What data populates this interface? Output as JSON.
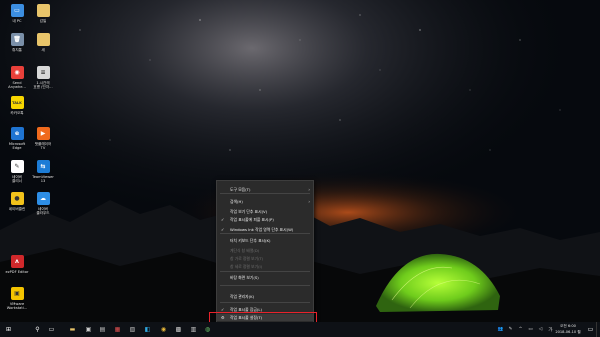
{
  "desktop_icons": [
    {
      "label": "내 PC",
      "icon": "pc-icon",
      "color": "#3c8ee0",
      "glyph": "▭"
    },
    {
      "label": "감일",
      "icon": "folder-icon",
      "color": "#e8c46a",
      "glyph": ""
    },
    {
      "label": "휴지통",
      "icon": "recycle-bin-icon",
      "color": "#7a8fa8",
      "glyph": "🗑"
    },
    {
      "label": "새",
      "icon": "folder-icon",
      "color": "#e8c46a",
      "glyph": ""
    },
    {
      "label": "Send\nAnywhe...",
      "icon": "send-anywhere-icon",
      "color": "#e8403a",
      "glyph": "◉"
    },
    {
      "label": "1.시간의\n흐름 (단자...",
      "icon": "document-icon",
      "color": "#d8d8d8",
      "glyph": "≡"
    },
    {
      "label": "카카오톡",
      "icon": "kakaotalk-icon",
      "color": "#f7d600",
      "glyph": "TALK"
    },
    {
      "label": "Microsoft\nEdge",
      "icon": "edge-icon",
      "color": "#1f74d2",
      "glyph": "e"
    },
    {
      "label": "팟플레이어\nTV",
      "icon": "potplayer-icon",
      "color": "#f06a1d",
      "glyph": "▶"
    },
    {
      "label": "네이버\n클리너",
      "icon": "naver-cleaner-icon",
      "color": "#ffffff",
      "glyph": "✎"
    },
    {
      "label": "TeamViewer\n13",
      "icon": "teamviewer-icon",
      "color": "#1c7cd6",
      "glyph": "⇆"
    },
    {
      "label": "네이버클린",
      "icon": "naver-clean-icon",
      "color": "#f2c21b",
      "glyph": "●"
    },
    {
      "label": "네이버\n클라우드",
      "icon": "naver-cloud-icon",
      "color": "#2d8ee6",
      "glyph": "☁"
    },
    {
      "label": "ezPDF Editor",
      "icon": "ezpdf-icon",
      "color": "#d0282b",
      "glyph": "ʌ"
    },
    {
      "label": "VMware\nWorkstati...",
      "icon": "vmware-icon",
      "color": "#f4c400",
      "glyph": "▣"
    }
  ],
  "context_menu": {
    "items": [
      {
        "label": "도구 모음(T)",
        "checked": false,
        "submenu": true,
        "disabled": false
      },
      {
        "label": "검색(H)",
        "checked": false,
        "submenu": true,
        "disabled": false
      },
      {
        "label": "작업 보기 단추 표시(V)",
        "checked": false,
        "submenu": false,
        "disabled": false
      },
      {
        "label": "작업 표시줄에 피플 표시(P)",
        "checked": true,
        "submenu": false,
        "disabled": false
      },
      {
        "label": "Windows Ink 작업 영역 단추 표시(W)",
        "checked": true,
        "submenu": false,
        "disabled": false
      },
      {
        "label": "터치 키보드 단추 표시(K)",
        "checked": false,
        "submenu": false,
        "disabled": false
      },
      {
        "label": "계단식 창 배열(D)",
        "checked": false,
        "submenu": false,
        "disabled": true
      },
      {
        "label": "창 가로 정렬 보기(T)",
        "checked": false,
        "submenu": false,
        "disabled": true
      },
      {
        "label": "창 세로 정렬 보기(I)",
        "checked": false,
        "submenu": false,
        "disabled": true
      },
      {
        "label": "바탕 화면 보기(S)",
        "checked": false,
        "submenu": false,
        "disabled": false
      },
      {
        "label": "작업 관리자(K)",
        "checked": false,
        "submenu": false,
        "disabled": false
      },
      {
        "label": "작업 표시줄 잠금(L)",
        "checked": true,
        "submenu": false,
        "disabled": false
      },
      {
        "label": "작업 표시줄 설정(T)",
        "checked": false,
        "submenu": false,
        "disabled": false,
        "icon": "gear-icon"
      }
    ]
  },
  "taskbar": {
    "apps": [
      {
        "icon": "start-icon",
        "glyph": "⊞",
        "color": "#ffffff"
      },
      {
        "icon": "search-icon",
        "glyph": "⚲",
        "color": "#ffffff"
      },
      {
        "icon": "task-view-icon",
        "glyph": "▭",
        "color": "#ffffff"
      },
      {
        "icon": "explorer-icon",
        "glyph": "▬",
        "color": "#e8c46a"
      },
      {
        "icon": "app-icon",
        "glyph": "▣",
        "color": "#cccccc"
      },
      {
        "icon": "app-icon",
        "glyph": "▤",
        "color": "#c8c8c8"
      },
      {
        "icon": "app-icon",
        "glyph": "▦",
        "color": "#e05050"
      },
      {
        "icon": "app-icon",
        "glyph": "▧",
        "color": "#bbbbbb"
      },
      {
        "icon": "app-icon",
        "glyph": "◧",
        "color": "#2ea8e0"
      },
      {
        "icon": "chrome-icon",
        "glyph": "◉",
        "color": "#e8b83a"
      },
      {
        "icon": "app-icon",
        "glyph": "▩",
        "color": "#cccccc"
      },
      {
        "icon": "app-icon",
        "glyph": "▥",
        "color": "#cfcfcf"
      },
      {
        "icon": "app-icon",
        "glyph": "◍",
        "color": "#6ac46a"
      }
    ],
    "tray": [
      {
        "icon": "people-icon",
        "glyph": "👥",
        "color": "#dddddd"
      },
      {
        "icon": "ink-icon",
        "glyph": "✎",
        "color": "#dddddd"
      },
      {
        "icon": "chevron-up-icon",
        "glyph": "^",
        "color": "#dddddd"
      },
      {
        "icon": "network-icon",
        "glyph": "▭",
        "color": "#dddddd"
      },
      {
        "icon": "volume-icon",
        "glyph": "◁",
        "color": "#dddddd"
      },
      {
        "icon": "ime-icon",
        "glyph": "가",
        "color": "#dddddd"
      }
    ],
    "clock": {
      "time": "오전 6:00",
      "date": "2018-06-10 월"
    },
    "notification_icon": {
      "icon": "notification-icon",
      "glyph": "▭"
    }
  }
}
